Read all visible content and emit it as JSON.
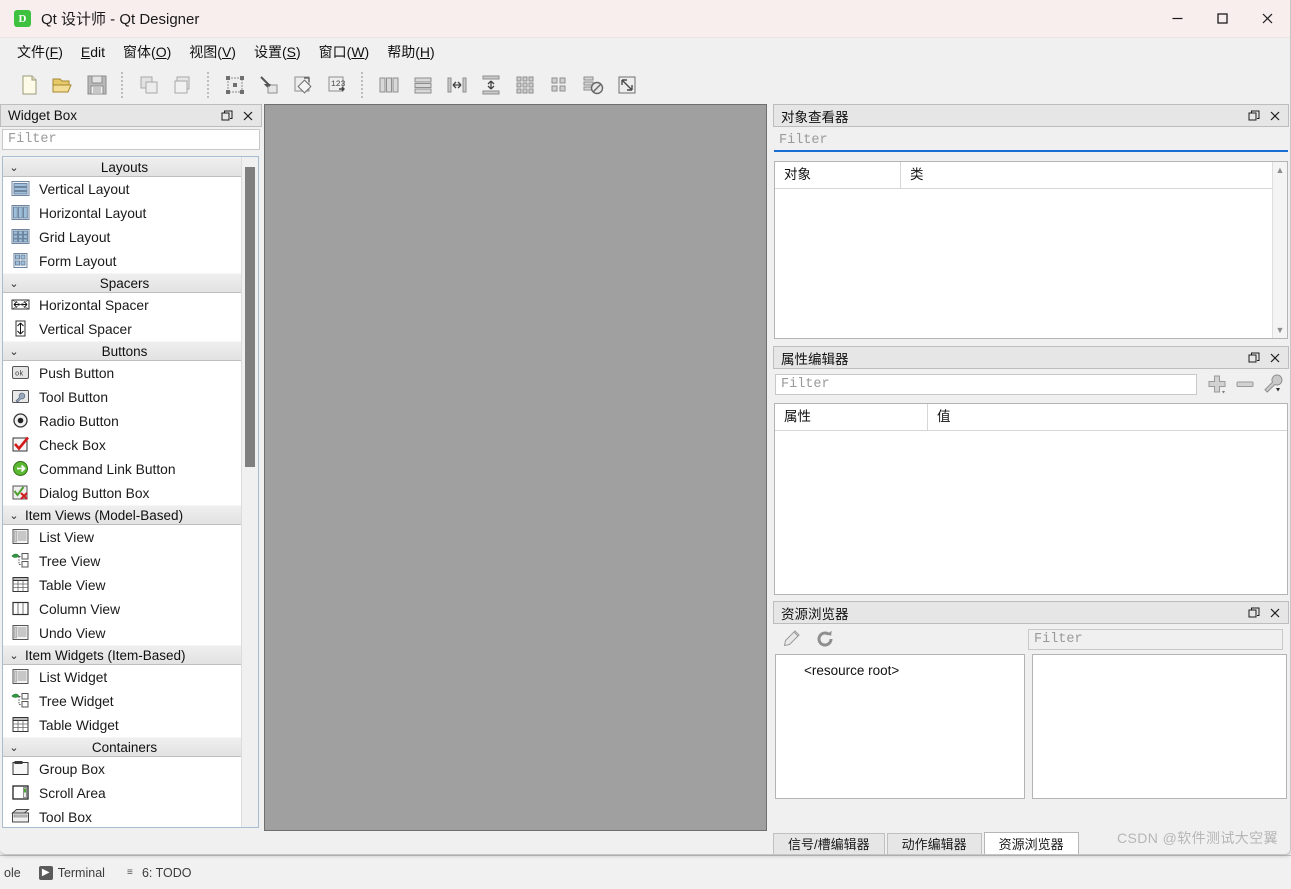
{
  "window": {
    "title": "Qt 设计师 - Qt Designer",
    "app_icon": "D",
    "minimize": "minimize-icon",
    "maximize": "maximize-icon",
    "close": "close-icon"
  },
  "menubar": {
    "items": [
      {
        "pre": "文件(",
        "key": "F",
        "post": ")"
      },
      {
        "pre": "",
        "key": "E",
        "post": "dit"
      },
      {
        "pre": "窗体(",
        "key": "O",
        "post": ")"
      },
      {
        "pre": "视图(",
        "key": "V",
        "post": ")"
      },
      {
        "pre": "设置(",
        "key": "S",
        "post": ")"
      },
      {
        "pre": "窗口(",
        "key": "W",
        "post": ")"
      },
      {
        "pre": "帮助(",
        "key": "H",
        "post": ")"
      }
    ]
  },
  "toolbar": {
    "groups": [
      [
        "new-file-icon",
        "open-folder-icon",
        "save-icon"
      ],
      [
        "copy-icon",
        "paste-icon"
      ],
      [
        "edit-widgets-icon",
        "edit-signals-slots-icon",
        "edit-buddies-icon",
        "edit-tab-order-icon"
      ],
      [
        "layout-horizontal-icon",
        "layout-vertical-icon",
        "layout-splitter-horizontal-icon",
        "layout-splitter-vertical-icon",
        "layout-grid-icon",
        "layout-form-icon",
        "break-layout-icon",
        "adjust-size-icon"
      ]
    ]
  },
  "widget_box": {
    "title": "Widget Box",
    "filter_placeholder": "Filter",
    "filter_value": "",
    "float_btn": "restore-icon",
    "close_btn": "close-icon",
    "categories": [
      {
        "name": "Layouts",
        "align": "center",
        "expanded": true,
        "items": [
          {
            "label": "Vertical Layout",
            "icon": "vertical-layout-icon"
          },
          {
            "label": "Horizontal Layout",
            "icon": "horizontal-layout-icon"
          },
          {
            "label": "Grid Layout",
            "icon": "grid-layout-icon"
          },
          {
            "label": "Form Layout",
            "icon": "form-layout-icon"
          }
        ]
      },
      {
        "name": "Spacers",
        "align": "center",
        "expanded": true,
        "items": [
          {
            "label": "Horizontal Spacer",
            "icon": "horizontal-spacer-icon"
          },
          {
            "label": "Vertical Spacer",
            "icon": "vertical-spacer-icon"
          }
        ]
      },
      {
        "name": "Buttons",
        "align": "center",
        "expanded": true,
        "items": [
          {
            "label": "Push Button",
            "icon": "push-button-icon"
          },
          {
            "label": "Tool Button",
            "icon": "tool-button-icon"
          },
          {
            "label": "Radio Button",
            "icon": "radio-button-icon"
          },
          {
            "label": "Check Box",
            "icon": "check-box-icon"
          },
          {
            "label": "Command Link Button",
            "icon": "command-link-button-icon"
          },
          {
            "label": "Dialog Button Box",
            "icon": "dialog-button-box-icon"
          }
        ]
      },
      {
        "name": "Item Views (Model-Based)",
        "align": "left",
        "expanded": true,
        "items": [
          {
            "label": "List View",
            "icon": "list-view-icon"
          },
          {
            "label": "Tree View",
            "icon": "tree-view-icon"
          },
          {
            "label": "Table View",
            "icon": "table-view-icon"
          },
          {
            "label": "Column View",
            "icon": "column-view-icon"
          },
          {
            "label": "Undo View",
            "icon": "undo-view-icon"
          }
        ]
      },
      {
        "name": "Item Widgets (Item-Based)",
        "align": "left",
        "expanded": true,
        "items": [
          {
            "label": "List Widget",
            "icon": "list-widget-icon"
          },
          {
            "label": "Tree Widget",
            "icon": "tree-widget-icon"
          },
          {
            "label": "Table Widget",
            "icon": "table-widget-icon"
          }
        ]
      },
      {
        "name": "Containers",
        "align": "center",
        "expanded": true,
        "items": [
          {
            "label": "Group Box",
            "icon": "group-box-icon"
          },
          {
            "label": "Scroll Area",
            "icon": "scroll-area-icon"
          },
          {
            "label": "Tool Box",
            "icon": "tool-box-icon"
          }
        ]
      }
    ]
  },
  "object_inspector": {
    "title": "对象查看器",
    "filter_placeholder": "Filter",
    "filter_value": "",
    "columns": [
      "对象",
      "类"
    ],
    "rows": []
  },
  "property_editor": {
    "title": "属性编辑器",
    "filter_placeholder": "Filter",
    "filter_value": "",
    "add_btn": "plus-icon",
    "remove_btn": "minus-icon",
    "configure_btn": "wrench-icon",
    "columns": [
      "属性",
      "值"
    ],
    "rows": []
  },
  "resource_browser": {
    "title": "资源浏览器",
    "edit_btn": "pencil-icon",
    "reload_btn": "reload-icon",
    "filter_placeholder": "Filter",
    "filter_value": "",
    "tree_root": "<resource root>",
    "files": []
  },
  "bottom_tabs": {
    "items": [
      {
        "label": "信号/槽编辑器",
        "active": false
      },
      {
        "label": "动作编辑器",
        "active": false
      },
      {
        "label": "资源浏览器",
        "active": true
      }
    ]
  },
  "host_statusbar": {
    "items": [
      {
        "label": "ole",
        "icon": ""
      },
      {
        "label": "Terminal",
        "icon": "terminal-icon"
      },
      {
        "label": "6: TODO",
        "icon": "list-icon"
      }
    ]
  },
  "watermark": "CSDN @软件测试大空翼",
  "colors": {
    "titlebar": "#f9eeee",
    "chrome": "#f0f0f0",
    "canvas": "#a0a0a0",
    "accent": "#1a6fd4",
    "dock_header": "#e6e6e6"
  }
}
